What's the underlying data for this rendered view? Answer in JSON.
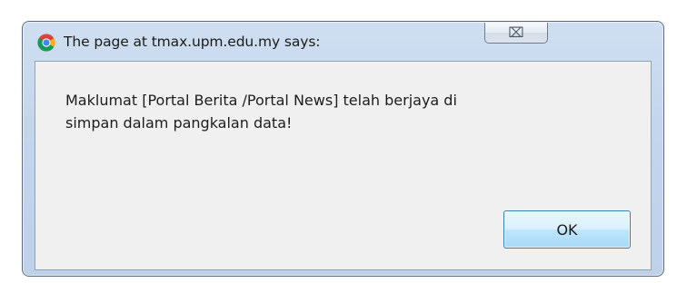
{
  "dialog": {
    "title": "The page at tmax.upm.edu.my says:",
    "close_icon": "close-icon",
    "close_glyph": "⌧",
    "app_icon": "chrome-icon",
    "message_line1": "Maklumat [Portal Berita /Portal News] telah berjaya di",
    "message_line2": "simpan dalam pangkalan data!",
    "ok_label": "OK"
  }
}
